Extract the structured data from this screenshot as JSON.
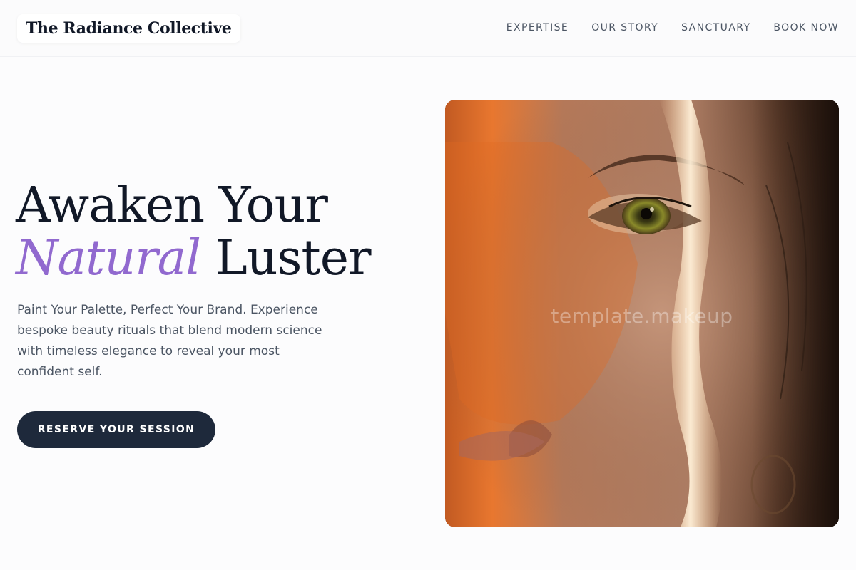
{
  "brand": {
    "name": "The Radiance Collective"
  },
  "nav": {
    "items": [
      {
        "label": "EXPERTISE"
      },
      {
        "label": "OUR STORY"
      },
      {
        "label": "SANCTUARY"
      },
      {
        "label": "BOOK NOW"
      }
    ]
  },
  "hero": {
    "title_line1": "Awaken Your",
    "title_accent": "Natural",
    "title_line2_rest": " Luster",
    "description": "Paint Your Palette, Perfect Your Brand. Experience bespoke beauty rituals that blend modern science with timeless elegance to reveal your most confident self.",
    "cta_label": "RESERVE YOUR SESSION",
    "image_watermark": "template.makeup"
  },
  "colors": {
    "accent": "#9169cf",
    "button": "#1e293b",
    "heading": "#111827",
    "body_text": "#4b5563"
  }
}
